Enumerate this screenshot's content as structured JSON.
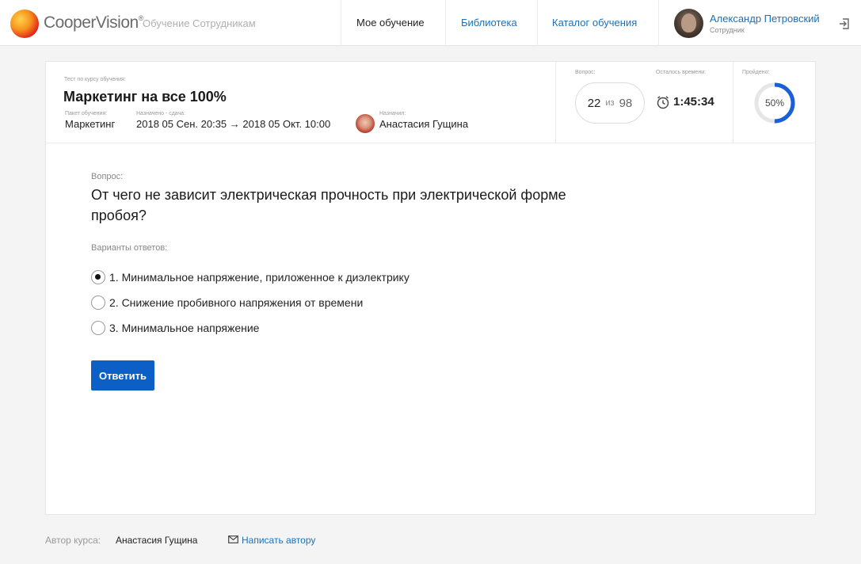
{
  "brand": {
    "logo_text": "CooperVision",
    "logo_mark": "®",
    "subtitle": "Обучение Сотрудникам"
  },
  "nav": {
    "items": [
      {
        "label": "Мое обучение",
        "active": true
      },
      {
        "label": "Библиотека",
        "active": false
      },
      {
        "label": "Каталог обучения",
        "active": false
      }
    ]
  },
  "user": {
    "name": "Александр Петровский",
    "role": "Сотрудник"
  },
  "course": {
    "caption": "Тест по курсу обучения:",
    "title": "Маркетинг на все 100%",
    "package_caption": "Пакет обучения:",
    "package": "Маркетинг",
    "dates_caption": "Назначено - сдача:",
    "dates": "2018 05 Сен. 20:35 → 2018 05 Окт. 10:00",
    "assigner_caption": "Назначил:",
    "assigner": "Анастасия Гущина"
  },
  "stats": {
    "question_caption": "Вопрос:",
    "question_current": "22",
    "question_of": "из",
    "question_total": "98",
    "time_caption": "Осталось времени:",
    "time_left": "1:45:34",
    "passed_caption": "Пройдено:",
    "passed_label": "50%",
    "passed_fraction": 0.5,
    "ring_color": "#1a5fd6",
    "ring_track_color": "#e6e6e6"
  },
  "question": {
    "caption": "Вопрос:",
    "text": "От чего не зависит  электрическая прочность при электрической форме пробоя?",
    "answers_caption": "Варианты ответов:",
    "answers": [
      {
        "label": "1. Минимальное напряжение, приложенное к диэлектрику",
        "selected": true
      },
      {
        "label": "2. Снижение пробивного напряжения от времени",
        "selected": false
      },
      {
        "label": "3. Минимальное напряжение",
        "selected": false
      }
    ],
    "submit_label": "Ответить",
    "submit_color": "#0b5fc6"
  },
  "footer": {
    "author_caption": "Автор курса:",
    "author": "Анастасия Гущина",
    "contact_label": "Написать автору"
  },
  "icons": {
    "logout": "logout-icon",
    "clock": "clock-icon",
    "mail": "mail-icon"
  }
}
